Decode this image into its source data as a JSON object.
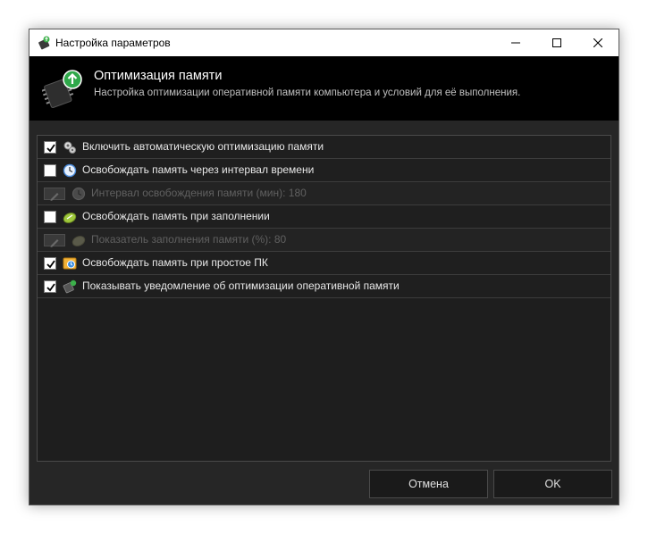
{
  "window": {
    "title": "Настройка параметров",
    "controls": [
      "minimize-icon",
      "maximize-icon",
      "close-icon"
    ]
  },
  "banner": {
    "icon": "memory-chip-upload-icon",
    "heading": "Оптимизация памяти",
    "description": "Настройка оптимизации оперативной памяти компьютера и условий для её выполнения."
  },
  "options": [
    {
      "label": "Включить автоматическую оптимизацию памяти",
      "checked": true,
      "enabled": true,
      "icon": "gears-icon"
    },
    {
      "label": "Освобождать память через интервал времени",
      "checked": false,
      "enabled": true,
      "icon": "clock-icon"
    },
    {
      "label": "Интервал освобождения памяти (мин): 180",
      "enabled": false,
      "icon": "clock-icon",
      "sub": true
    },
    {
      "label": "Освобождать память при заполнении",
      "checked": false,
      "enabled": true,
      "icon": "gauge-icon"
    },
    {
      "label": "Показатель заполнения памяти (%): 80",
      "enabled": false,
      "icon": "gauge-icon",
      "sub": true
    },
    {
      "label": "Освобождать память при простое ПК",
      "checked": true,
      "enabled": true,
      "icon": "idle-pc-icon"
    },
    {
      "label": "Показывать уведомление об оптимизации оперативной памяти",
      "checked": true,
      "enabled": true,
      "icon": "chip-notify-icon"
    }
  ],
  "buttons": {
    "cancel": "Отмена",
    "ok": "OK"
  }
}
